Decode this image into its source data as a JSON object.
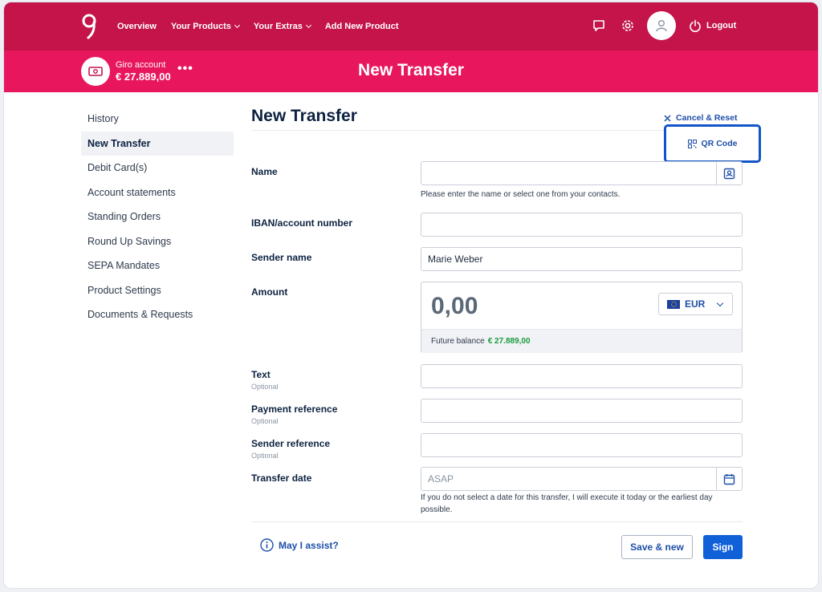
{
  "nav": {
    "items": [
      {
        "label": "Overview",
        "has_dropdown": false
      },
      {
        "label": "Your Products",
        "has_dropdown": true
      },
      {
        "label": "Your Extras",
        "has_dropdown": true
      },
      {
        "label": "Add New Product",
        "has_dropdown": false
      }
    ],
    "icons": [
      "chat-icon",
      "gear-icon",
      "user-icon",
      "power-icon"
    ],
    "logout_label": "Logout"
  },
  "account": {
    "name": "Giro account",
    "balance": "€ 27.889,00",
    "more": "•••"
  },
  "page_title": "New Transfer",
  "sidebar": {
    "items": [
      {
        "label": "History",
        "active": false
      },
      {
        "label": "New Transfer",
        "active": true
      },
      {
        "label": "Debit Card(s)",
        "active": false
      },
      {
        "label": "Account statements",
        "active": false
      },
      {
        "label": "Standing Orders",
        "active": false
      },
      {
        "label": "Round Up Savings",
        "active": false
      },
      {
        "label": "SEPA Mandates",
        "active": false
      },
      {
        "label": "Product Settings",
        "active": false
      },
      {
        "label": "Documents & Requests",
        "active": false
      }
    ]
  },
  "form": {
    "title": "New Transfer",
    "cancel_reset": "Cancel & Reset",
    "qr_code": "QR Code",
    "name": {
      "label": "Name",
      "value": "",
      "hint": "Please enter the name or select one from your contacts."
    },
    "iban": {
      "label": "IBAN/account number",
      "value": ""
    },
    "sender_name": {
      "label": "Sender name",
      "value": "Marie Weber"
    },
    "amount": {
      "label": "Amount",
      "value": "0,00",
      "currency": "EUR",
      "future_balance_label": "Future balance",
      "future_balance_value": "€ 27.889,00"
    },
    "text": {
      "label": "Text",
      "optional": "Optional",
      "value": ""
    },
    "payment_reference": {
      "label": "Payment reference",
      "optional": "Optional",
      "value": ""
    },
    "sender_reference": {
      "label": "Sender reference",
      "optional": "Optional",
      "value": ""
    },
    "transfer_date": {
      "label": "Transfer date",
      "placeholder": "ASAP",
      "hint": "If you do not select a date for this transfer, I will execute it today or the earliest day possible."
    },
    "assist": "May I assist?",
    "save_new": "Save & new",
    "sign": "Sign"
  },
  "colors": {
    "topbar": "#c4144a",
    "subbar": "#e8175d",
    "primary": "#1060d8",
    "link": "#1d4fa8",
    "positive": "#1a9b3e"
  }
}
